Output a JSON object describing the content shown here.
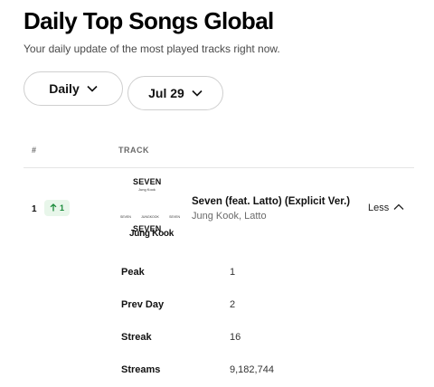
{
  "header": {
    "title": "Daily Top Songs Global",
    "subtitle": "Your daily update of the most played tracks right now."
  },
  "filters": {
    "period_label": "Daily",
    "date_label": "Jul 29"
  },
  "table": {
    "columns": {
      "rank": "#",
      "track": "TRACK"
    }
  },
  "entry": {
    "rank": "1",
    "trend_value": "1",
    "trend_direction": "up",
    "trend_color": "#1a8a3a",
    "title": "Seven (feat. Latto) (Explicit Ver.)",
    "artist": "Jung Kook, Latto",
    "toggle_label": "Less",
    "cover": {
      "top_text": "SEVEN",
      "sub_text": "Jung Kook",
      "row_texts": [
        "SEVEN",
        "JUNGKOOK",
        "SEVEN"
      ],
      "big_text_1": "SEVEN",
      "big_text_2": "Jung Kook"
    },
    "stats": [
      {
        "label": "Peak",
        "value": "1"
      },
      {
        "label": "Prev Day",
        "value": "2"
      },
      {
        "label": "Streak",
        "value": "16"
      },
      {
        "label": "Streams",
        "value": "9,182,744"
      }
    ]
  }
}
